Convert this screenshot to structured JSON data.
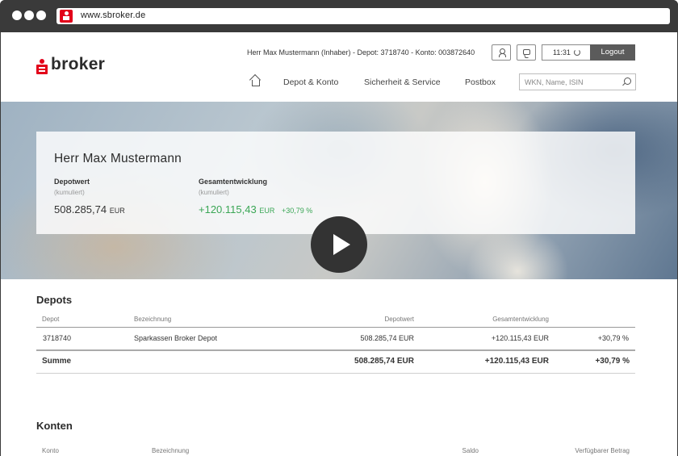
{
  "browser": {
    "url": "www.sbroker.de"
  },
  "header": {
    "logo_text": "broker",
    "user_info": "Herr Max Mustermann (Inhaber) - Depot: 3718740 - Konto: 003872640",
    "timer": "11:31",
    "logout_label": "Logout"
  },
  "nav": {
    "items": [
      "Depot & Konto",
      "Sicherheit & Service",
      "Postbox"
    ],
    "search_placeholder": "WKN, Name, ISIN"
  },
  "hero": {
    "name": "Herr Max Mustermann",
    "depotwert": {
      "label": "Depotwert",
      "sub": "(kumuliert)",
      "value": "508.285,74",
      "currency": "EUR"
    },
    "gesamt": {
      "label": "Gesamtentwicklung",
      "sub": "(kumuliert)",
      "value": "+120.115,43",
      "currency": "EUR",
      "percent": "+30,79 %"
    }
  },
  "depots": {
    "title": "Depots",
    "columns": [
      "Depot",
      "Bezeichnung",
      "Depotwert",
      "Gesamtentwicklung"
    ],
    "rows": [
      {
        "depot": "3718740",
        "bezeichnung": "Sparkassen Broker Depot",
        "depotwert": "508.285,74 EUR",
        "gesamt": "+120.115,43 EUR",
        "percent": "+30,79 %"
      }
    ],
    "sum": {
      "label": "Summe",
      "depotwert": "508.285,74 EUR",
      "gesamt": "+120.115,43 EUR",
      "percent": "+30,79 %"
    }
  },
  "konten": {
    "title": "Konten",
    "columns": [
      "Konto",
      "Bezeichnung",
      "Saldo",
      "Verfügbarer Betrag"
    ]
  },
  "colors": {
    "brand_red": "#e2001a",
    "positive_green": "#3aa655",
    "logout_bg": "#5b5b5b"
  }
}
